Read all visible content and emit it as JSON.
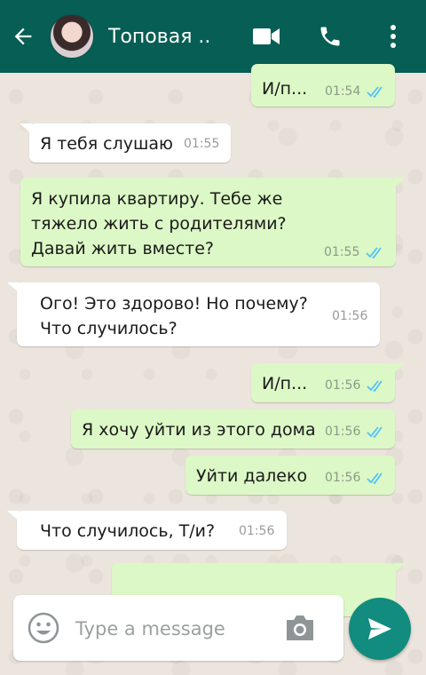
{
  "header": {
    "contact_name": "Топовая ..",
    "icons": [
      "back-arrow-icon",
      "video-call-icon",
      "phone-icon",
      "more-vertical-icon"
    ]
  },
  "messages": [
    {
      "direction": "out",
      "text": "И/п...",
      "time": "01:54",
      "status": "read"
    },
    {
      "direction": "in",
      "text": "Я тебя слушаю",
      "time": "01:55"
    },
    {
      "direction": "out",
      "lines": [
        "Я купила квартиру.  Тебе же",
        "тяжело жить с родителями?",
        "Давай жить вместе?"
      ],
      "time": "01:55",
      "status": "read"
    },
    {
      "direction": "in",
      "lines": [
        "Ого! Это здорово! Но почему?",
        "Что случилось?"
      ],
      "time": "01:56"
    },
    {
      "direction": "out",
      "text": "И/п...",
      "time": "01:56",
      "status": "read"
    },
    {
      "direction": "out",
      "text": "Я хочу уйти из этого дома",
      "time": "01:56",
      "status": "read"
    },
    {
      "direction": "out",
      "text": "Уйти далеко",
      "time": "01:56",
      "status": "read"
    },
    {
      "direction": "in",
      "text": "Что случилось, Т/и?",
      "time": "01:56"
    }
  ],
  "composer": {
    "placeholder": "Type a message"
  },
  "colors": {
    "header": "#075e54",
    "outgoing_bubble": "#dcf8c6",
    "incoming_bubble": "#ffffff",
    "read_ticks": "#4fc3f7",
    "send_button": "#128c7e"
  }
}
